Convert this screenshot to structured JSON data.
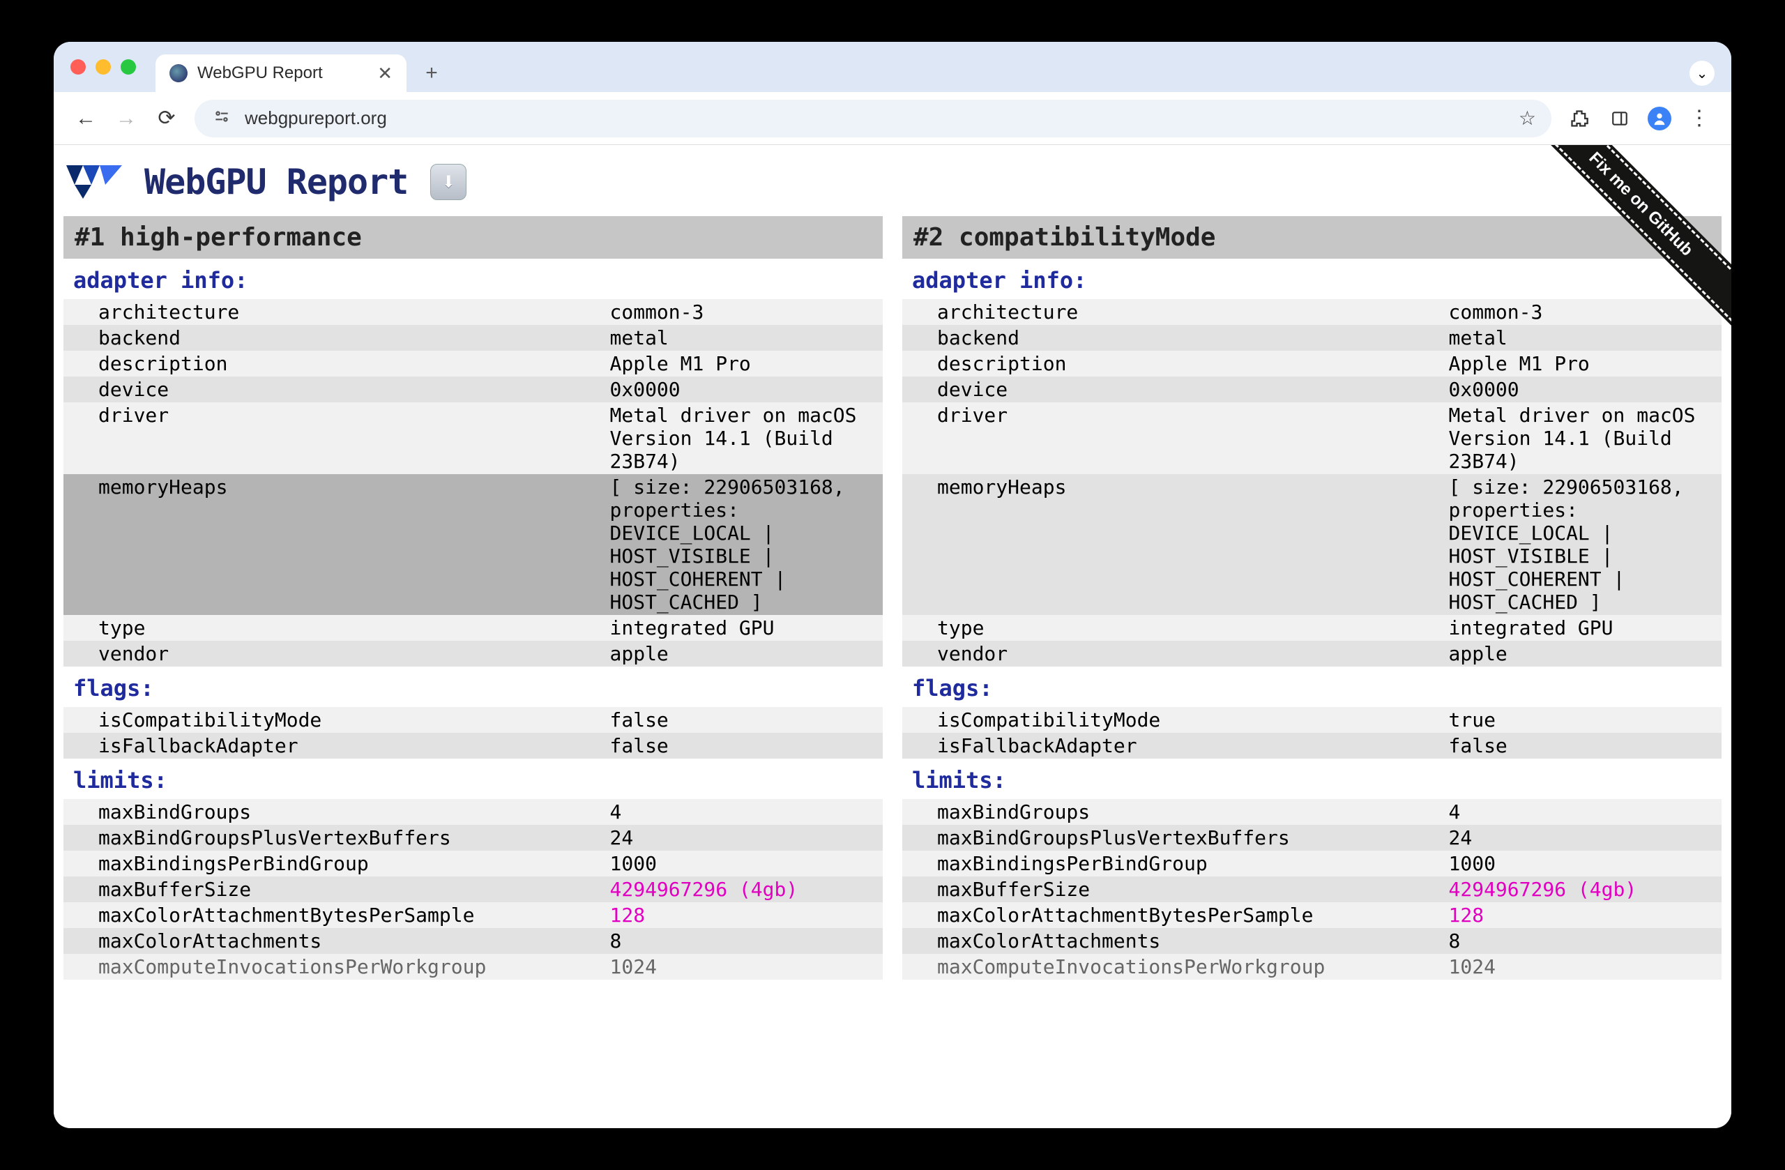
{
  "browser": {
    "tab_title": "WebGPU Report",
    "url": "webgpureport.org"
  },
  "page": {
    "title": "WebGPU Report",
    "download_tooltip": "download",
    "github_ribbon": "Fix me on GitHub"
  },
  "panels": [
    {
      "id": "p1",
      "title": "#1 high-performance",
      "sections": [
        {
          "title": "adapter info:",
          "rows": [
            {
              "k": "architecture",
              "v": "common-3"
            },
            {
              "k": "backend",
              "v": "metal"
            },
            {
              "k": "description",
              "v": "Apple M1 Pro"
            },
            {
              "k": "device",
              "v": "0x0000"
            },
            {
              "k": "driver",
              "v": "Metal driver on macOS Version 14.1 (Build 23B74)"
            },
            {
              "k": "memoryHeaps",
              "v": "[ size: 22906503168, properties: DEVICE_LOCAL | HOST_VISIBLE | HOST_COHERENT | HOST_CACHED ]",
              "highlight": true
            },
            {
              "k": "type",
              "v": "integrated GPU"
            },
            {
              "k": "vendor",
              "v": "apple"
            }
          ]
        },
        {
          "title": "flags:",
          "rows": [
            {
              "k": "isCompatibilityMode",
              "v": "false"
            },
            {
              "k": "isFallbackAdapter",
              "v": "false"
            }
          ]
        },
        {
          "title": "limits:",
          "rows": [
            {
              "k": "maxBindGroups",
              "v": "4"
            },
            {
              "k": "maxBindGroupsPlusVertexBuffers",
              "v": "24"
            },
            {
              "k": "maxBindingsPerBindGroup",
              "v": "1000"
            },
            {
              "k": "maxBufferSize",
              "v": "4294967296 (4gb)",
              "nondefault": true
            },
            {
              "k": "maxColorAttachmentBytesPerSample",
              "v": "128",
              "nondefault": true
            },
            {
              "k": "maxColorAttachments",
              "v": "8"
            },
            {
              "k": "maxComputeInvocationsPerWorkgroup",
              "v": "1024",
              "nondefault": true,
              "cutoff": true
            }
          ]
        }
      ]
    },
    {
      "id": "p2",
      "title": "#2 compatibilityMode",
      "sections": [
        {
          "title": "adapter info:",
          "rows": [
            {
              "k": "architecture",
              "v": "common-3"
            },
            {
              "k": "backend",
              "v": "metal"
            },
            {
              "k": "description",
              "v": "Apple M1 Pro"
            },
            {
              "k": "device",
              "v": "0x0000"
            },
            {
              "k": "driver",
              "v": "Metal driver on macOS Version 14.1 (Build 23B74)"
            },
            {
              "k": "memoryHeaps",
              "v": "[ size: 22906503168, properties: DEVICE_LOCAL | HOST_VISIBLE | HOST_COHERENT | HOST_CACHED ]"
            },
            {
              "k": "type",
              "v": "integrated GPU"
            },
            {
              "k": "vendor",
              "v": "apple"
            }
          ]
        },
        {
          "title": "flags:",
          "rows": [
            {
              "k": "isCompatibilityMode",
              "v": "true"
            },
            {
              "k": "isFallbackAdapter",
              "v": "false"
            }
          ]
        },
        {
          "title": "limits:",
          "rows": [
            {
              "k": "maxBindGroups",
              "v": "4"
            },
            {
              "k": "maxBindGroupsPlusVertexBuffers",
              "v": "24"
            },
            {
              "k": "maxBindingsPerBindGroup",
              "v": "1000"
            },
            {
              "k": "maxBufferSize",
              "v": "4294967296 (4gb)",
              "nondefault": true
            },
            {
              "k": "maxColorAttachmentBytesPerSample",
              "v": "128",
              "nondefault": true
            },
            {
              "k": "maxColorAttachments",
              "v": "8"
            },
            {
              "k": "maxComputeInvocationsPerWorkgroup",
              "v": "1024",
              "nondefault": true,
              "cutoff": true
            }
          ]
        }
      ]
    }
  ]
}
